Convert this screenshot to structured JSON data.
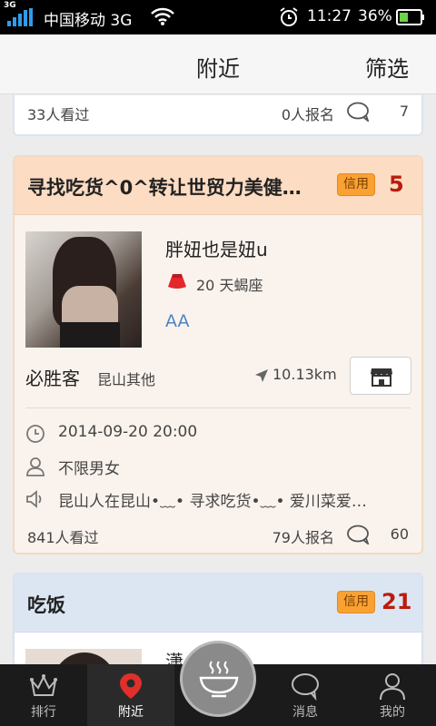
{
  "status_bar": {
    "network_badge": "3G",
    "carrier": "中国移动 3G",
    "time": "11:27",
    "battery": "36%",
    "icons": [
      "signal-icon",
      "wifi-icon",
      "alarm-icon",
      "battery-icon"
    ]
  },
  "header": {
    "title": "附近",
    "filter_label": "筛选"
  },
  "cards": [
    {
      "views": "33人看过",
      "signups": "0人报名",
      "comments": "7"
    },
    {
      "title": "寻找吃货^0^转让世贸力美健…",
      "badge": "信用",
      "count": "5",
      "nickname": "胖妞也是妞u",
      "age_sign": "20 天蝎座",
      "level": "AA",
      "shop_name": "必胜客",
      "district": "昆山其他",
      "distance": "10.13km",
      "datetime": "2014-09-20 20:00",
      "gender": "不限男女",
      "message": "昆山人在昆山•﹏• 寻求吃货•﹏• 爱川菜爱…",
      "views": "841人看过",
      "signups": "79人报名",
      "comments": "60"
    },
    {
      "title": "吃饭",
      "badge": "信用",
      "count": "21",
      "nickname": "潇"
    }
  ],
  "bottom_nav": {
    "tabs": [
      {
        "label": "排行",
        "icon": "crown-icon"
      },
      {
        "label": "附近",
        "icon": "location-pin-icon"
      },
      {
        "label": "",
        "icon": "bowl-icon"
      },
      {
        "label": "消息",
        "icon": "chat-bubble-icon"
      },
      {
        "label": "我的",
        "icon": "person-icon"
      }
    ],
    "active_tab": "附近"
  },
  "colors": {
    "accent_red": "#b91c0f",
    "badge_orange": "#f9a233",
    "card_head_peach": "#fcdcc2",
    "card_head_blue": "#dce6f3",
    "level_blue": "#4f83c4"
  }
}
